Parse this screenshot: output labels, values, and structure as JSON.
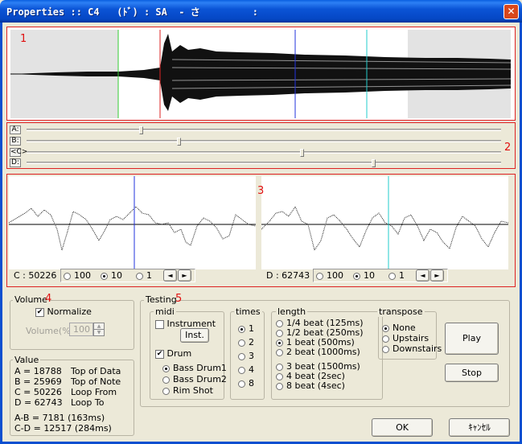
{
  "window": {
    "title": "Properties :: C4   (ﾄﾞ) : SA  - さ         :",
    "close_glyph": "✕"
  },
  "markers": {
    "m1": "1",
    "m2": "2",
    "m3": "3",
    "m4": "4",
    "m5": "5"
  },
  "sliders": [
    {
      "label": "A:",
      "value_fraction": 0.24
    },
    {
      "label": "B:",
      "value_fraction": 0.32
    },
    {
      "label": "<C>",
      "value_fraction": 0.58
    },
    {
      "label": "D:",
      "value_fraction": 0.73
    }
  ],
  "zoom_left": {
    "readout": "C : 50226",
    "options": [
      "100",
      "10",
      "1"
    ],
    "selected": "10"
  },
  "zoom_right": {
    "readout": "D : 62743",
    "options": [
      "100",
      "10",
      "1"
    ],
    "selected": "10"
  },
  "nav": {
    "left": "◄",
    "right": "►"
  },
  "volume": {
    "group_label": "Volume",
    "normalize_label": "Normalize",
    "normalize_checked": true,
    "volume_label": "Volume(%) :",
    "volume_value": "100"
  },
  "value": {
    "group_label": "Value",
    "rows": [
      {
        "left": "A = 18788",
        "right": "Top of Data"
      },
      {
        "left": "B = 25969",
        "right": "Top of Note"
      },
      {
        "left": "C = 50226",
        "right": "Loop From"
      },
      {
        "left": "D = 62743",
        "right": "Loop To"
      }
    ],
    "ab": "A-B = 7181 (163ms)",
    "cd": "C-D = 12517 (284ms)"
  },
  "testing": {
    "group_label": "Testing",
    "midi": {
      "group_label": "midi",
      "instrument_label": "Instrument",
      "inst_button": "Inst.",
      "drum_label": "Drum",
      "drum_checked": true,
      "drums": [
        "Bass Drum1",
        "Bass Drum2",
        "Rim Shot"
      ],
      "drum_selected": "Bass Drum1"
    },
    "times": {
      "group_label": "times",
      "options": [
        "1",
        "2",
        "3",
        "4",
        "8"
      ],
      "selected": "1"
    },
    "length": {
      "group_label": "length",
      "options": [
        "1/4 beat (125ms)",
        "1/2 beat (250ms)",
        "1 beat (500ms)",
        "2 beat (1000ms)",
        "3 beat (1500ms)",
        "4 beat (2sec)",
        "8 beat (4sec)"
      ],
      "selected": "1 beat (500ms)"
    },
    "transpose": {
      "group_label": "transpose",
      "options": [
        "None",
        "Upstairs",
        "Downstairs"
      ],
      "selected": "None"
    }
  },
  "buttons": {
    "play": "Play",
    "stop": "Stop",
    "ok": "OK",
    "cancel": "ｷｬﾝｾﾙ"
  },
  "colors": {
    "marker_a": "#33cc33",
    "marker_b": "#dd2222",
    "marker_c": "#2233dd",
    "marker_d": "#22cccc"
  }
}
